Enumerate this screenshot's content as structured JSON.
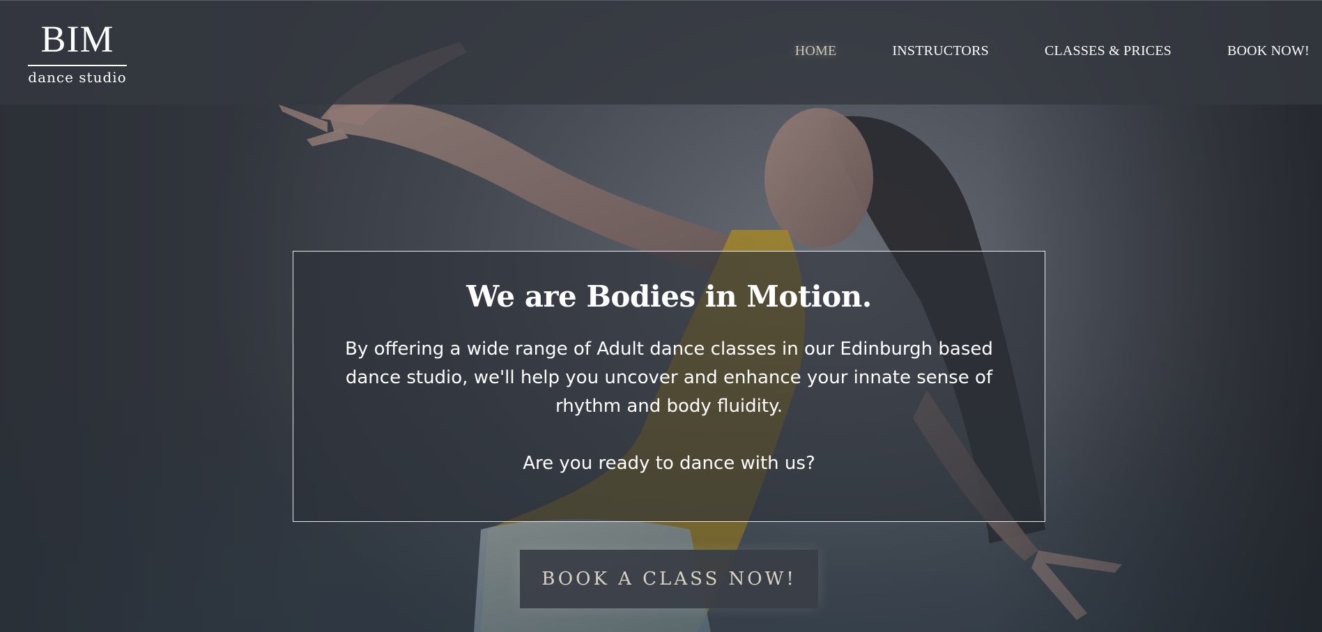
{
  "logo": {
    "main": "BIM",
    "sub": "dance studio"
  },
  "nav": {
    "items": [
      {
        "label": "HOME",
        "active": true
      },
      {
        "label": "INSTRUCTORS",
        "active": false
      },
      {
        "label": "CLASSES & PRICES",
        "active": false
      },
      {
        "label": "BOOK NOW!",
        "active": false
      }
    ]
  },
  "hero": {
    "heading": "We are Bodies in Motion.",
    "intro": "By offering a wide range of Adult dance classes in our Edinburgh based dance studio, we'll help you uncover and enhance your innate sense of rhythm and body fluidity.",
    "question": "Are you ready to dance with us?",
    "cta_label": "BOOK A CLASS NOW!"
  },
  "colors": {
    "header_bg": "#343840",
    "active_nav": "#cbc6ba",
    "cta_text": "#d9d3c6",
    "top_accent": "#f2c230"
  }
}
